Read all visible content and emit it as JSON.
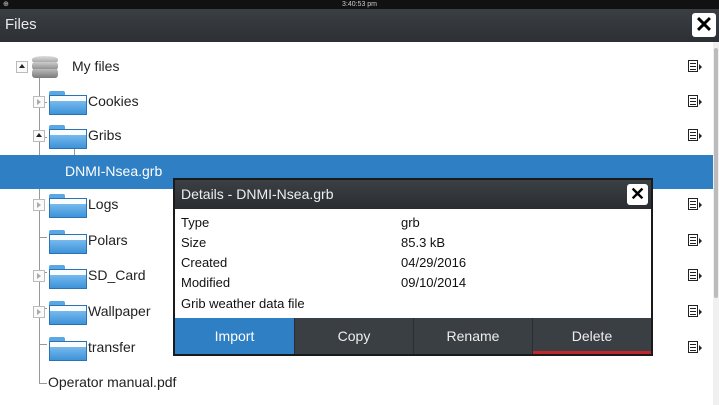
{
  "status": {
    "time": "3:40:53 pm",
    "gps_icon": "gps-icon"
  },
  "window": {
    "title": "Files",
    "close_icon": "close-icon"
  },
  "tree": {
    "root": "My files",
    "items": [
      {
        "label": "Cookies",
        "type": "folder",
        "expander": "collapsed"
      },
      {
        "label": "Gribs",
        "type": "folder",
        "expander": "expanded"
      },
      {
        "label": "DNMI-Nsea.grb",
        "type": "file",
        "selected": true
      },
      {
        "label": "Logs",
        "type": "folder",
        "expander": "collapsed"
      },
      {
        "label": "Polars",
        "type": "folder",
        "expander": "none"
      },
      {
        "label": "SD_Card",
        "type": "folder",
        "expander": "collapsed"
      },
      {
        "label": "Wallpaper",
        "type": "folder",
        "expander": "collapsed"
      },
      {
        "label": "transfer",
        "type": "folder",
        "expander": "none"
      },
      {
        "label": "Operator manual.pdf",
        "type": "file"
      }
    ]
  },
  "dialog": {
    "title": "Details - DNMI-Nsea.grb",
    "properties": [
      {
        "label": "Type",
        "value": "grb"
      },
      {
        "label": "Size",
        "value": "85.3 kB"
      },
      {
        "label": "Created",
        "value": "04/29/2016"
      },
      {
        "label": "Modified",
        "value": "09/10/2014"
      }
    ],
    "description": "Grib weather data file",
    "buttons": {
      "import": "Import",
      "copy": "Copy",
      "rename": "Rename",
      "delete": "Delete"
    }
  },
  "colors": {
    "selection": "#2e7fc4",
    "titlebar": "#2c3034",
    "delete_accent": "#c0272d"
  }
}
